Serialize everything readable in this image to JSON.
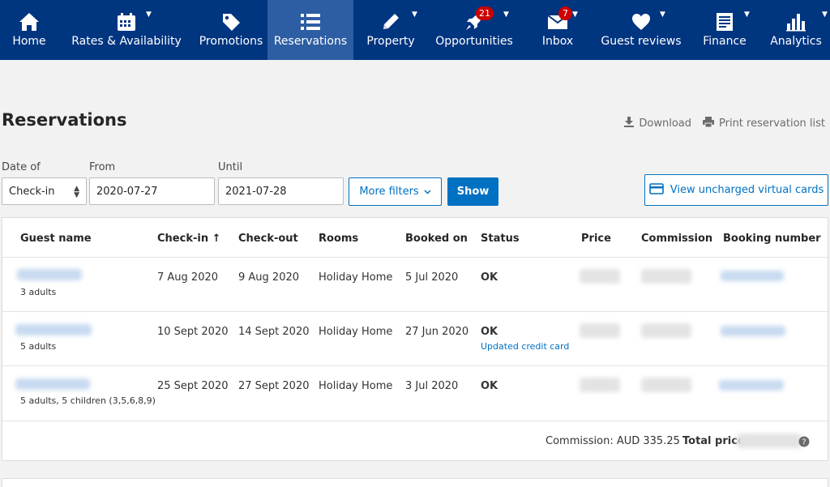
{
  "nav": {
    "items": [
      {
        "label": "Home",
        "icon": "home-icon"
      },
      {
        "label": "Rates & Availability",
        "icon": "calendar-icon"
      },
      {
        "label": "Promotions",
        "icon": "tag-icon"
      },
      {
        "label": "Reservations",
        "icon": "list-icon"
      },
      {
        "label": "Property",
        "icon": "pencil-icon"
      },
      {
        "label": "Opportunities",
        "icon": "rocket-icon",
        "badge": "21"
      },
      {
        "label": "Inbox",
        "icon": "envelope-icon",
        "badge": "7"
      },
      {
        "label": "Guest reviews",
        "icon": "heart-icon"
      },
      {
        "label": "Finance",
        "icon": "document-icon"
      },
      {
        "label": "Analytics",
        "icon": "bar-chart-icon"
      }
    ],
    "active": "Reservations"
  },
  "page": {
    "title": "Reservations",
    "download": "Download",
    "print": "Print reservation list"
  },
  "filters": {
    "date_of_label": "Date of",
    "date_of_value": "Check-in",
    "from_label": "From",
    "from_value": "2020-07-27",
    "until_label": "Until",
    "until_value": "2021-07-28",
    "more_filters": "More filters",
    "show": "Show",
    "view_cards": "View uncharged virtual cards"
  },
  "table": {
    "headers": {
      "guest": "Guest name",
      "checkin": "Check-in ↑",
      "checkout": "Check-out",
      "rooms": "Rooms",
      "booked": "Booked on",
      "status": "Status",
      "price": "Price",
      "commission": "Commission",
      "booking": "Booking number"
    },
    "rows": [
      {
        "guests": "3 adults",
        "checkin": "7 Aug 2020",
        "checkout": "9 Aug 2020",
        "room": "Holiday Home",
        "booked": "5 Jul 2020",
        "status": "OK",
        "note": ""
      },
      {
        "guests": "5 adults",
        "checkin": "10 Sept 2020",
        "checkout": "14 Sept 2020",
        "room": "Holiday Home",
        "booked": "27 Jun 2020",
        "status": "OK",
        "note": "Updated credit card"
      },
      {
        "guests": "5 adults, 5 children (3,5,6,8,9)",
        "checkin": "25 Sept 2020",
        "checkout": "27 Sept 2020",
        "room": "Holiday Home",
        "booked": "3 Jul 2020",
        "status": "OK",
        "note": ""
      }
    ],
    "footer": {
      "commission": "Commission: AUD 335.25",
      "total_label": "Total price"
    }
  }
}
